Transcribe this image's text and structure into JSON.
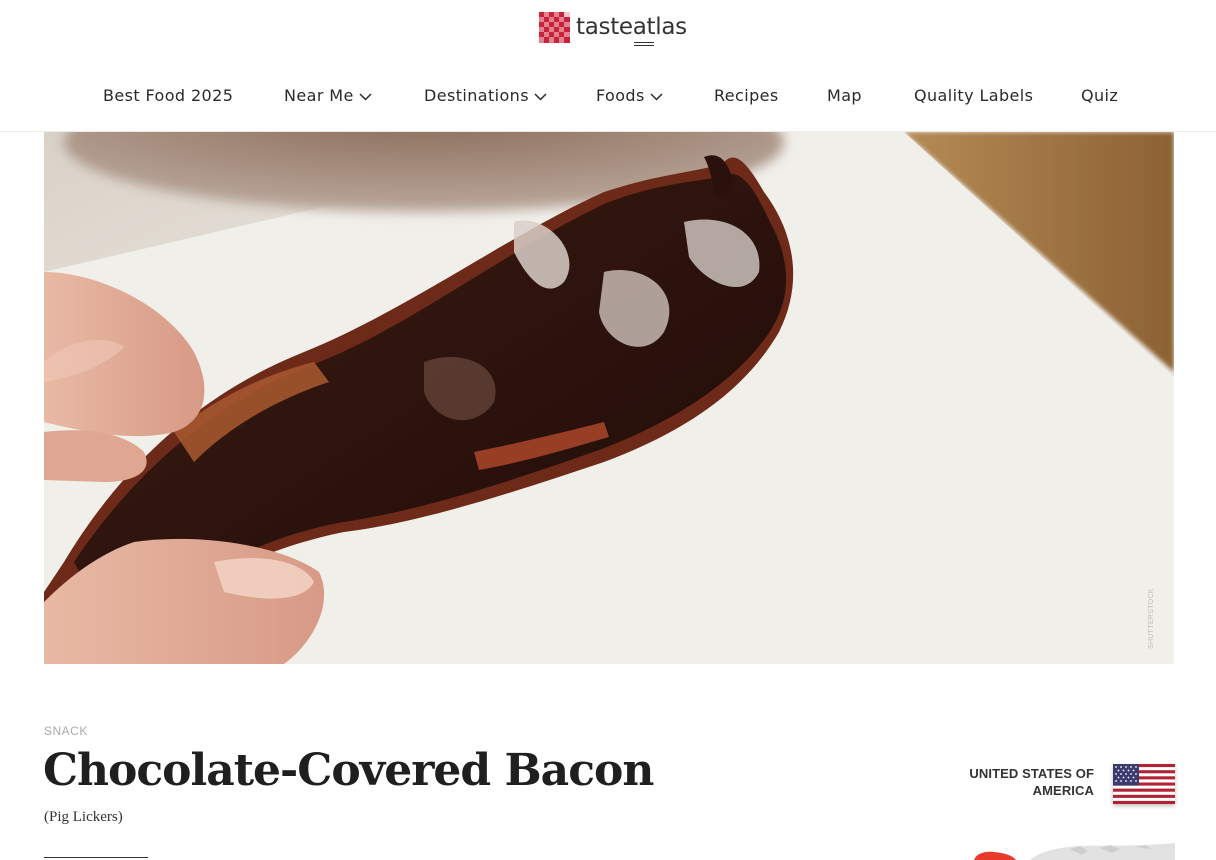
{
  "brand": {
    "name": "tasteatlas",
    "name_plain": "taste",
    "name_underlined": "at",
    "name_tail": "las",
    "accent_color": "#c8233a"
  },
  "nav": {
    "items": [
      {
        "label": "Best Food 2025",
        "dropdown": false
      },
      {
        "label": "Near Me",
        "dropdown": true
      },
      {
        "label": "Destinations",
        "dropdown": true
      },
      {
        "label": "Foods",
        "dropdown": true
      },
      {
        "label": "Recipes",
        "dropdown": false
      },
      {
        "label": "Map",
        "dropdown": false
      },
      {
        "label": "Quality Labels",
        "dropdown": false
      },
      {
        "label": "Quiz",
        "dropdown": false
      }
    ]
  },
  "hero": {
    "credit": "SHUTTERSTOCK"
  },
  "dish": {
    "category": "SNACK",
    "title": "Chocolate-Covered Bacon",
    "subtitle": "(Pig Lickers)",
    "country_line1": "UNITED STATES OF",
    "country_line2": "AMERICA"
  },
  "colors": {
    "map_highlight": "#e8392a",
    "nav_text": "#2a2a2a"
  },
  "icons": {
    "logo": "checkered-tablecloth-icon",
    "dropdown": "chevron-down-icon",
    "flag": "us-flag-icon"
  }
}
